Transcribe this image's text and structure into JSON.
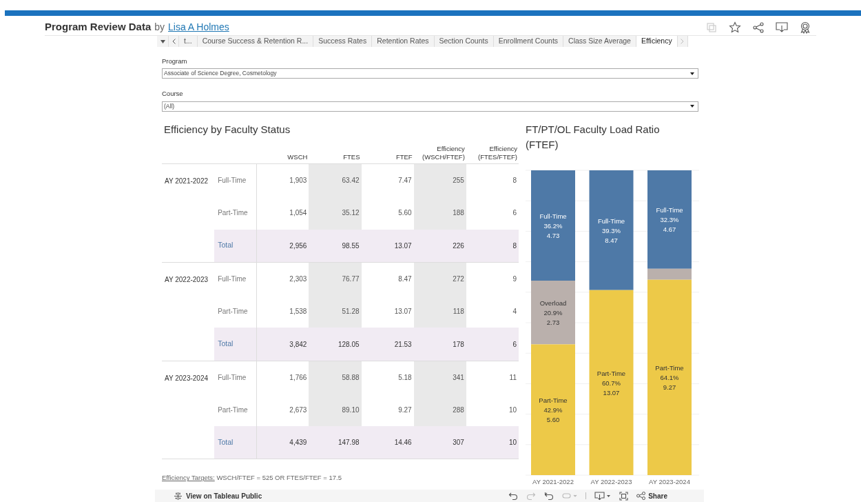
{
  "header": {
    "title": "Program Review Data",
    "by": "by",
    "author": "Lisa A Holmes"
  },
  "tabs": [
    {
      "label": "t...",
      "selected": false
    },
    {
      "label": "Course Success & Retention R...",
      "selected": false
    },
    {
      "label": "Success Rates",
      "selected": false
    },
    {
      "label": "Retention Rates",
      "selected": false
    },
    {
      "label": "Section Counts",
      "selected": false
    },
    {
      "label": "Enrollment Counts",
      "selected": false
    },
    {
      "label": "Class Size Average",
      "selected": false
    },
    {
      "label": "Efficiency",
      "selected": true
    }
  ],
  "filters": [
    {
      "label": "Program",
      "value": "Associate of Science Degree, Cosmetology"
    },
    {
      "label": "Course",
      "value": "(All)"
    }
  ],
  "table": {
    "title": "Efficiency by Faculty Status",
    "columns": [
      "WSCH",
      "FTES",
      "FTEF",
      "Efficiency (WSCH/FTEF)",
      "Efficiency (FTES/FTEF)"
    ],
    "groups": [
      {
        "year": "AY 2021-2022",
        "rows": [
          {
            "kind": "detail",
            "status": "Full-Time",
            "cells": [
              "1,903",
              "63.42",
              "7.47",
              "255",
              "8"
            ]
          },
          {
            "kind": "detail",
            "status": "Part-Time",
            "cells": [
              "1,054",
              "35.12",
              "5.60",
              "188",
              "6"
            ]
          },
          {
            "kind": "total",
            "status": "Total",
            "cells": [
              "2,956",
              "98.55",
              "13.07",
              "226",
              "8"
            ]
          }
        ]
      },
      {
        "year": "AY 2022-2023",
        "rows": [
          {
            "kind": "detail",
            "status": "Full-Time",
            "cells": [
              "2,303",
              "76.77",
              "8.47",
              "272",
              "9"
            ]
          },
          {
            "kind": "detail",
            "status": "Part-Time",
            "cells": [
              "1,538",
              "51.28",
              "13.07",
              "118",
              "4"
            ]
          },
          {
            "kind": "total",
            "status": "Total",
            "cells": [
              "3,842",
              "128.05",
              "21.53",
              "178",
              "6"
            ]
          }
        ]
      },
      {
        "year": "AY 2023-2024",
        "rows": [
          {
            "kind": "detail",
            "status": "Full-Time",
            "cells": [
              "1,766",
              "58.88",
              "5.18",
              "341",
              "11"
            ]
          },
          {
            "kind": "detail",
            "status": "Part-Time",
            "cells": [
              "2,673",
              "89.10",
              "9.27",
              "288",
              "10"
            ]
          },
          {
            "kind": "total",
            "status": "Total",
            "cells": [
              "4,439",
              "147.98",
              "14.46",
              "307",
              "10"
            ]
          }
        ]
      }
    ]
  },
  "footnote": {
    "link": "Efficiency Targets:",
    "text": "WSCH/FTEF = 525 OR FTES/FTEF = 17.5"
  },
  "chart": {
    "chart_data": {
      "type": "bar",
      "title": "FT/PT/OL Faculty Load Ratio (FTEF)",
      "stacked": true,
      "data_labels": true,
      "categories": [
        "AY 2021-2022",
        "AY 2022-2023",
        "AY 2023-2024"
      ],
      "series": [
        {
          "name": "Full-Time",
          "color": "#4e79a7",
          "values": [
            36.2,
            39.3,
            32.3
          ],
          "value_labels": [
            "36.2%\n4.73",
            "39.3%\n8.47",
            "32.3%\n4.67"
          ]
        },
        {
          "name": "Overload",
          "color": "#bab0ac",
          "values": [
            20.9,
            null,
            3.6
          ],
          "value_labels": [
            "20.9%\n2.73",
            null,
            null
          ]
        },
        {
          "name": "Part-Time",
          "color": "#edc948",
          "values": [
            42.9,
            60.7,
            64.1
          ],
          "value_labels": [
            "42.9%\n5.60",
            "60.7%\n13.07",
            "64.1%\n9.27"
          ]
        }
      ]
    }
  },
  "footer": {
    "link": "View on Tableau Public",
    "share": "Share"
  }
}
